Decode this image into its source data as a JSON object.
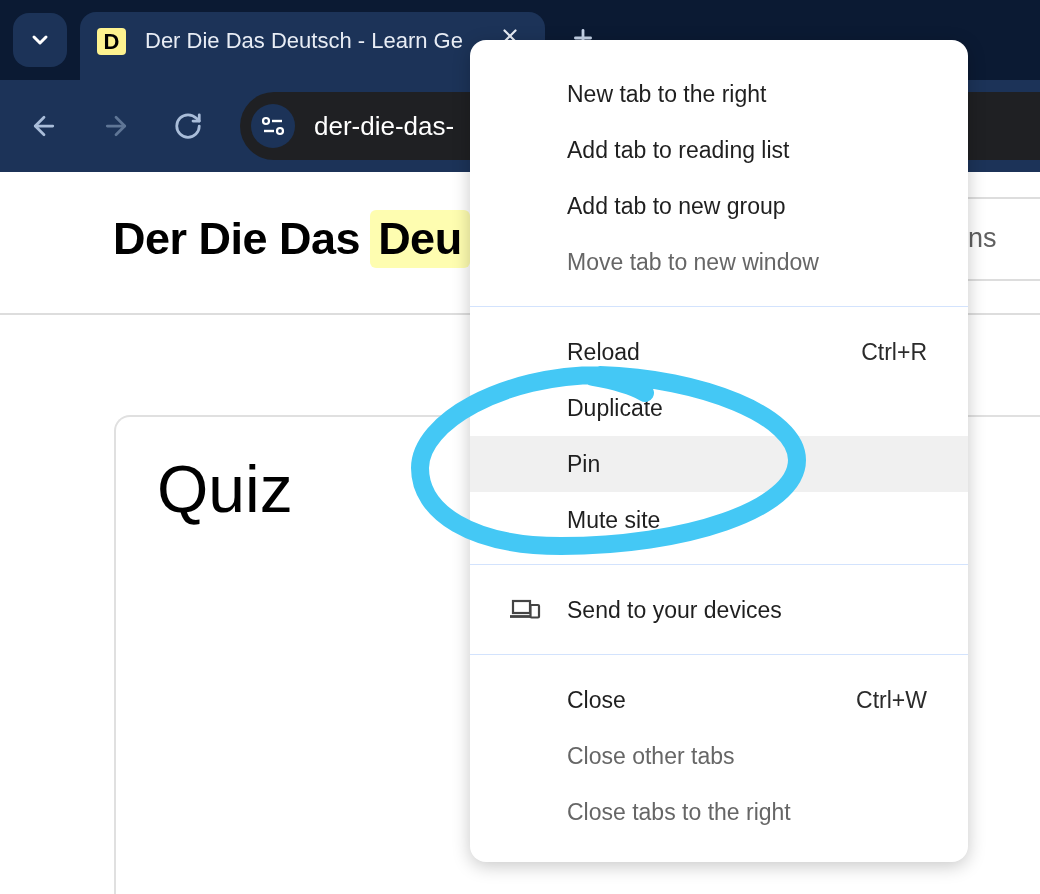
{
  "tab_strip": {
    "tabs": [
      {
        "favicon": "D",
        "title": "Der Die Das Deutsch - Learn Ge",
        "selected": true
      }
    ]
  },
  "toolbar": {
    "nav_buttons": [
      {
        "kind": "back",
        "disabled": false
      },
      {
        "kind": "forward",
        "disabled": true
      },
      {
        "kind": "reload",
        "disabled": false
      }
    ],
    "address_bar": {
      "value": "der-die-das-"
    }
  },
  "page_header": {
    "logo": [
      {
        "text": "Der Die Das",
        "highlighted": false
      },
      {
        "text": "Deu",
        "highlighted": true
      }
    ],
    "nav_button": {
      "label": "ns"
    }
  },
  "quiz_card": {
    "title": "Quiz"
  },
  "context_menu": {
    "groups": [
      {
        "items": [
          {
            "kind": "plain",
            "label": "New tab to the right",
            "disabled": false,
            "highlighted": false,
            "circled": false
          },
          {
            "kind": "plain",
            "label": "Add tab to reading list",
            "disabled": false,
            "highlighted": false,
            "circled": false
          },
          {
            "kind": "plain",
            "label": "Add tab to new group",
            "disabled": false,
            "highlighted": false,
            "circled": false
          },
          {
            "kind": "plain",
            "label": "Move tab to new window",
            "disabled": true,
            "highlighted": false,
            "circled": false
          }
        ]
      },
      {
        "items": [
          {
            "kind": "plain",
            "label": "Reload",
            "shortcut": "Ctrl+R",
            "disabled": false,
            "highlighted": false,
            "circled": false
          },
          {
            "kind": "plain",
            "label": "Duplicate",
            "disabled": false,
            "highlighted": false,
            "circled": false
          },
          {
            "kind": "plain",
            "label": "Pin",
            "disabled": false,
            "highlighted": true,
            "circled": true
          },
          {
            "kind": "plain",
            "label": "Mute site",
            "disabled": false,
            "highlighted": false,
            "circled": false
          }
        ]
      },
      {
        "items": [
          {
            "kind": "send",
            "label": "Send to your devices",
            "disabled": false,
            "highlighted": false,
            "circled": false
          }
        ]
      },
      {
        "items": [
          {
            "kind": "plain",
            "label": "Close",
            "shortcut": "Ctrl+W",
            "disabled": false,
            "highlighted": false,
            "circled": false
          },
          {
            "kind": "plain",
            "label": "Close other tabs",
            "disabled": true,
            "highlighted": false,
            "circled": false
          },
          {
            "kind": "plain",
            "label": "Close tabs to the right",
            "disabled": true,
            "highlighted": false,
            "circled": false
          }
        ]
      }
    ]
  }
}
